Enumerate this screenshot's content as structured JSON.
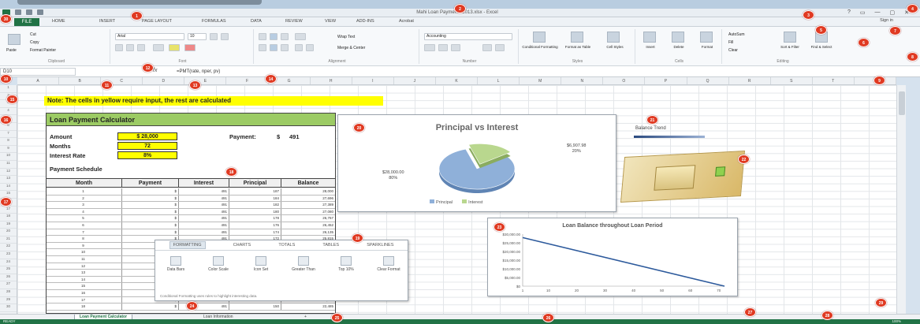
{
  "app": {
    "title": "Mahi Loan Payments 2013.xlsx - Excel",
    "file_tab": "FILE",
    "tabs": [
      "HOME",
      "INSERT",
      "PAGE LAYOUT",
      "FORMULAS",
      "DATA",
      "REVIEW",
      "VIEW",
      "ADD-INS",
      "Acrobat"
    ],
    "sign_in": "Sign in",
    "window_controls": [
      "?",
      "▭",
      "—",
      "▢",
      "✕"
    ],
    "accent_color": "#217346"
  },
  "ribbon": {
    "clipboard": {
      "paste": "Paste",
      "cut": "Cut",
      "copy": "Copy",
      "format_painter": "Format Painter",
      "group": "Clipboard"
    },
    "font": {
      "name": "Arial",
      "size": "10",
      "group": "Font"
    },
    "alignment": {
      "wrap": "Wrap Text",
      "merge": "Merge & Center",
      "group": "Alignment"
    },
    "number": {
      "format": "Accounting",
      "group": "Number"
    },
    "styles": {
      "conditional": "Conditional Formatting",
      "table": "Format as Table",
      "cell": "Cell Styles",
      "group": "Styles"
    },
    "cells": {
      "insert": "Insert",
      "delete": "Delete",
      "format": "Format",
      "group": "Cells"
    },
    "editing": {
      "autosum": "AutoSum",
      "fill": "Fill",
      "clear": "Clear",
      "sort": "Sort & Filter",
      "find": "Find & Select",
      "group": "Editing"
    }
  },
  "formula_bar": {
    "name_box": "D10",
    "fx": "fx",
    "formula": "=PMT(rate, nper, pv)"
  },
  "columns": [
    "A",
    "B",
    "C",
    "D",
    "E",
    "F",
    "G",
    "H",
    "I",
    "J",
    "K",
    "L",
    "M",
    "N",
    "O",
    "P",
    "Q",
    "R",
    "S",
    "T",
    "U"
  ],
  "rows": [
    "1",
    "2",
    "3",
    "4",
    "5",
    "6",
    "7",
    "8",
    "9",
    "10",
    "11",
    "12",
    "13",
    "14",
    "15",
    "16",
    "17",
    "18",
    "19",
    "20",
    "21",
    "22",
    "23",
    "24",
    "25",
    "26",
    "27",
    "28",
    "29",
    "30"
  ],
  "sheet": {
    "note": "Note: The cells in yellow require input, the rest are calculated",
    "calc_title": "Loan Payment Calculator",
    "amount_label": "Amount",
    "amount_value": "$ 28,000",
    "months_label": "Months",
    "months_value": "72",
    "rate_label": "Interest Rate",
    "rate_value": "8%",
    "payment_label": "Payment:",
    "payment_currency": "$",
    "payment_value": "491",
    "schedule_label": "Payment Schedule",
    "schedule_headers": [
      "Month",
      "Payment",
      "Interest",
      "Principal",
      "Balance"
    ],
    "schedule_rows": [
      [
        "1",
        "$",
        "491",
        "187",
        "28,000"
      ],
      [
        "2",
        "$",
        "491",
        "184",
        "27,696"
      ],
      [
        "3",
        "$",
        "491",
        "182",
        "27,389"
      ],
      [
        "4",
        "$",
        "491",
        "180",
        "27,080"
      ],
      [
        "5",
        "$",
        "491",
        "178",
        "26,767"
      ],
      [
        "6",
        "$",
        "491",
        "176",
        "26,452"
      ],
      [
        "7",
        "$",
        "491",
        "174",
        "26,135"
      ],
      [
        "8",
        "$",
        "491",
        "172",
        "25,815"
      ],
      [
        "9",
        "$",
        "491",
        "170",
        "25,493"
      ],
      [
        "10",
        "$",
        "491",
        "168",
        "25,168"
      ],
      [
        "11",
        "$",
        "491",
        "166",
        "24,841"
      ],
      [
        "12",
        "$",
        "491",
        "163",
        "24,512"
      ],
      [
        "13",
        "$",
        "491",
        "161",
        "24,180"
      ],
      [
        "14",
        "$",
        "491",
        "159",
        "23,846"
      ],
      [
        "15",
        "$",
        "491",
        "157",
        "23,509"
      ],
      [
        "16",
        "$",
        "491",
        "155",
        "23,170"
      ],
      [
        "17",
        "$",
        "491",
        "152",
        "22,829"
      ],
      [
        "18",
        "$",
        "491",
        "150",
        "22,485"
      ]
    ]
  },
  "pie": {
    "title": "Principal vs Interest",
    "principal_label": "$28,000.00",
    "principal_pct": "80%",
    "interest_label": "$6,907.98",
    "interest_pct": "20%",
    "legend": [
      "Principal",
      "Interest"
    ],
    "colors": {
      "principal": "#8fb0d9",
      "interest": "#b9d78e"
    }
  },
  "balance_line": {
    "title": "Loan Balance throughout Loan Period",
    "y_ticks": [
      "$30,000.00",
      "$25,000.00",
      "$20,000.00",
      "$15,000.00",
      "$10,000.00",
      "$5,000.00",
      "$0"
    ],
    "x_ticks": [
      "1",
      "10",
      "20",
      "30",
      "40",
      "50",
      "60",
      "70"
    ],
    "color": "#2d5a9c"
  },
  "balance_text": {
    "label": "Balance Trend"
  },
  "quick_analysis": {
    "tabs": [
      "FORMATTING",
      "CHARTS",
      "TOTALS",
      "TABLES",
      "SPARKLINES"
    ],
    "items": [
      "Data Bars",
      "Color Scale",
      "Icon Set",
      "Greater Than",
      "Top 10%",
      "Clear Format"
    ],
    "footer": "Conditional Formatting uses rules to highlight interesting data."
  },
  "sheet_tabs": [
    "Loan Payment Calculator",
    "Loan Information"
  ],
  "sheet_add": "+",
  "status": {
    "ready": "READY",
    "zoom": "100%"
  },
  "chart_data": [
    {
      "type": "pie",
      "title": "Principal vs Interest",
      "categories": [
        "Principal",
        "Interest"
      ],
      "values": [
        28000,
        6907.98
      ],
      "labels": [
        "$28,000.00 80%",
        "$6,907.98 20%"
      ],
      "legend": "bottom"
    },
    {
      "type": "line",
      "title": "Loan Balance throughout Loan Period",
      "x": [
        1,
        72
      ],
      "series": [
        {
          "values": [
            28000,
            0
          ]
        }
      ],
      "ylim": [
        0,
        30000
      ],
      "xlim": [
        1,
        72
      ],
      "y_ticks": [
        "$30,000.00",
        "$25,000.00",
        "$20,000.00",
        "$15,000.00",
        "$10,000.00",
        "$5,000.00",
        "$0"
      ],
      "x_ticks": [
        "1",
        "10",
        "20",
        "30",
        "40",
        "50",
        "60",
        "70"
      ]
    }
  ],
  "callouts": [
    "1",
    "2",
    "3",
    "4",
    "5",
    "6",
    "7",
    "8",
    "9",
    "10",
    "11",
    "12",
    "13",
    "14",
    "15",
    "16",
    "17",
    "18",
    "19",
    "20",
    "21",
    "22",
    "23",
    "24",
    "25",
    "26",
    "27",
    "28",
    "29",
    "30"
  ]
}
